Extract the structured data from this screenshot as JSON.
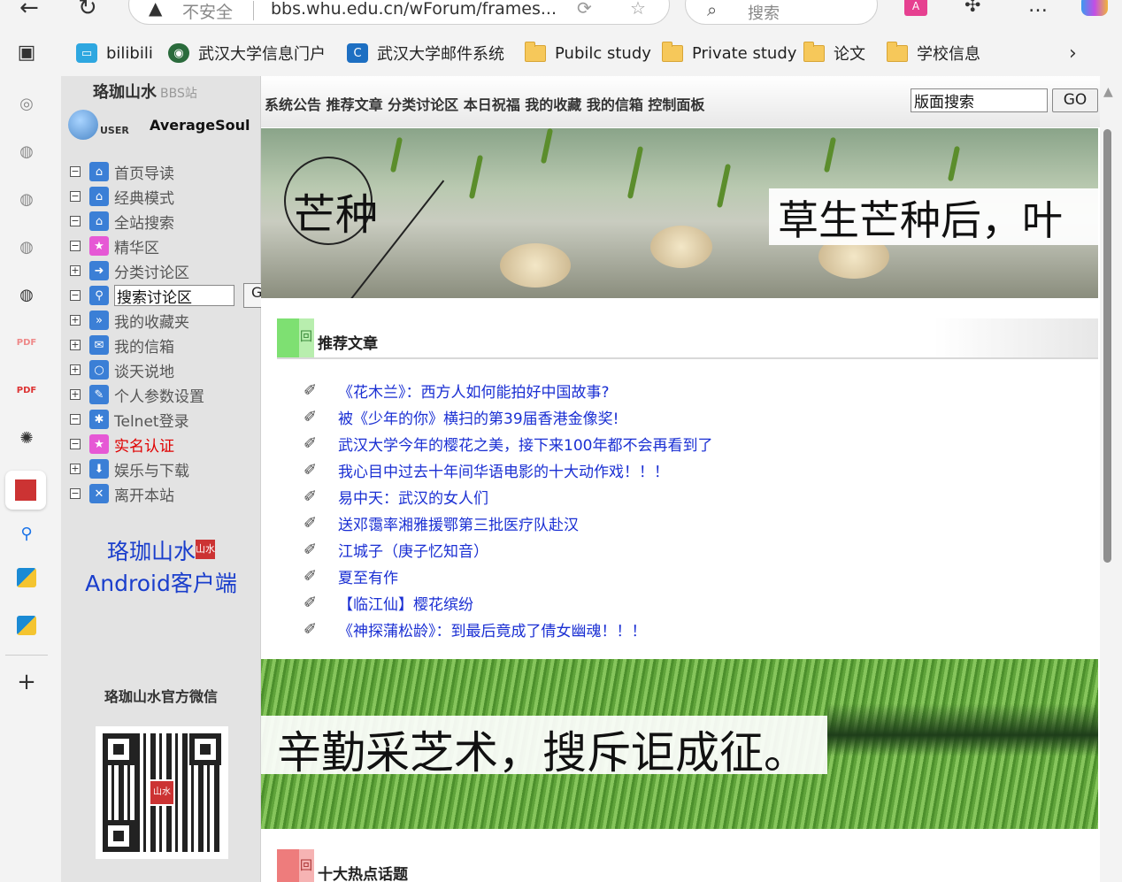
{
  "browser": {
    "insecure_label": "不安全",
    "url": "bbs.whu.edu.cn/wForum/frames...",
    "search_placeholder": "搜索"
  },
  "bookmarks": [
    {
      "label": "bilibili",
      "icon": "bilibili-icon",
      "color": "#2ea7e0"
    },
    {
      "label": "武汉大学信息门户",
      "icon": "whu-icon",
      "color": "#2a6b3c"
    },
    {
      "label": "武汉大学邮件系统",
      "icon": "mail-c-icon",
      "color": "#1d6fc2"
    },
    {
      "label": "Pubilc study",
      "icon": "folder-icon"
    },
    {
      "label": "Private study",
      "icon": "folder-icon"
    },
    {
      "label": "论文",
      "icon": "folder-icon"
    },
    {
      "label": "学校信息",
      "icon": "folder-icon"
    }
  ],
  "site": {
    "logo": "珞珈山水",
    "logo_sub": "BBS站",
    "user_label": "USER",
    "username": "AverageSoul"
  },
  "tree": [
    {
      "box": "−",
      "label": "首页导读",
      "icon": "home-icon"
    },
    {
      "box": "−",
      "label": "经典模式",
      "icon": "home-icon"
    },
    {
      "box": "−",
      "label": "全站搜索",
      "icon": "home-icon"
    },
    {
      "box": "−",
      "label": "精华区",
      "icon": "star-icon"
    },
    {
      "box": "+",
      "label": "分类讨论区",
      "icon": "arrow-icon"
    },
    {
      "box": "−",
      "label": "搜索讨论区",
      "icon": "search-icon"
    },
    {
      "box": "+",
      "label": "我的收藏夹",
      "icon": "favorite-icon"
    },
    {
      "box": "+",
      "label": "我的信箱",
      "icon": "mailbox-icon"
    },
    {
      "box": "+",
      "label": "谈天说地",
      "icon": "chat-icon"
    },
    {
      "box": "+",
      "label": "个人参数设置",
      "icon": "settings-icon"
    },
    {
      "box": "−",
      "label": "Telnet登录",
      "icon": "telnet-icon"
    },
    {
      "box": "−",
      "label": "实名认证",
      "icon": "star-icon"
    },
    {
      "box": "+",
      "label": "娱乐与下载",
      "icon": "download-icon"
    },
    {
      "box": "−",
      "label": "离开本站",
      "icon": "exit-icon"
    }
  ],
  "tree_search_value": "搜索讨论区",
  "tree_go": "G",
  "android": {
    "line1": "珞珈山水",
    "seal": "山水",
    "line2": "Android客户端"
  },
  "wechat_title": "珞珈山水官方微信",
  "menu": {
    "links": "系统公告 推荐文章 分类讨论区 本日祝福 我的收藏 我的信箱 控制面板",
    "board_search_value": "版面搜索",
    "go": "GO"
  },
  "banner1": {
    "title": "芒种",
    "quote": "草生芒种后，叶"
  },
  "recommended": {
    "title": "推荐文章",
    "articles": [
      "《花木兰》：西方人如何能拍好中国故事?",
      "被《少年的你》横扫的第39届香港金像奖!",
      "武汉大学今年的樱花之美，接下来100年都不会再看到了",
      "我心目中过去十年间华语电影的十大动作戏！！！",
      "易中天：武汉的女人们",
      "送邓霭率湘雅援鄂第三批医疗队赴汉",
      "江城子（庚子忆知音）",
      "夏至有作",
      "【临江仙】樱花缤纷",
      "《神探蒲松龄》：到最后竟成了倩女幽魂！！！"
    ]
  },
  "banner2": {
    "quote": "辛勤采芝术，搜斥讵成征。"
  },
  "hot": {
    "title": "十大热点话题"
  }
}
